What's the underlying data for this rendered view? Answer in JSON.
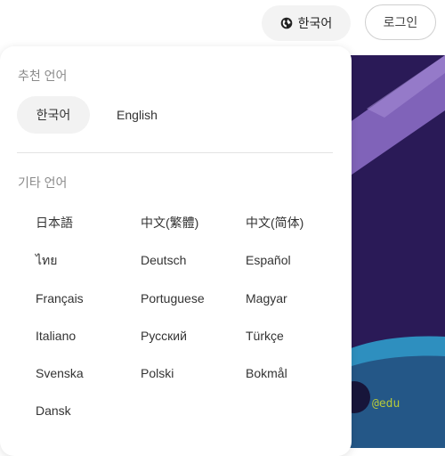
{
  "header": {
    "language_button_label": "한국어",
    "login_label": "로그인"
  },
  "background": {
    "watermark_text": "@edu",
    "colors": {
      "hero_bg": "#2a1a57",
      "stripe": "#8a6bc4",
      "wave": "#2e8fbf",
      "watermark": "#b7c93a"
    }
  },
  "dropdown": {
    "recommended_title": "추천 언어",
    "recommended": [
      {
        "label": "한국어",
        "selected": true
      },
      {
        "label": "English",
        "selected": false
      }
    ],
    "other_title": "기타 언어",
    "other_languages": [
      "日本語",
      "中文(繁體)",
      "中文(简体)",
      "ไทย",
      "Deutsch",
      "Español",
      "Français",
      "Portuguese",
      "Magyar",
      "Italiano",
      "Русский",
      "Türkçe",
      "Svenska",
      "Polski",
      "Bokmål",
      "Dansk"
    ]
  },
  "icons": {
    "language_button": "globe-icon"
  }
}
